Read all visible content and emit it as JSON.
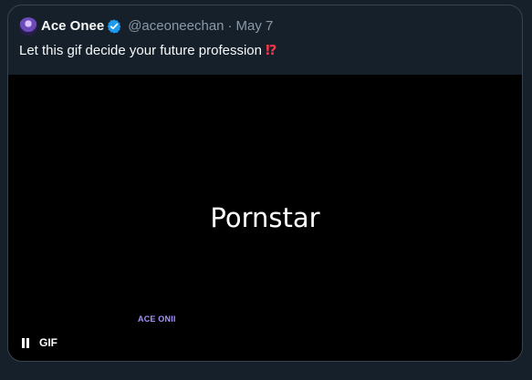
{
  "tweet": {
    "author_name": "Ace Onee",
    "handle": "@aceoneechan",
    "separator": "·",
    "date": "May 7",
    "text": "Let this gif decide your future profession",
    "emoji": "⁉"
  },
  "media": {
    "displayed_word": "Pornstar",
    "watermark": "ACE ONII",
    "badge": "GIF"
  },
  "icons": {
    "avatar": "avatar",
    "verified": "verified-badge-icon",
    "pause": "pause-icon"
  },
  "colors": {
    "background": "#15202b",
    "border": "#38444d",
    "primary_text": "#f7f9f9",
    "secondary_text": "#8b98a5",
    "verified_blue": "#1d9bf0",
    "emoji_red": "#f0374a",
    "watermark_purple": "#a593ff"
  }
}
